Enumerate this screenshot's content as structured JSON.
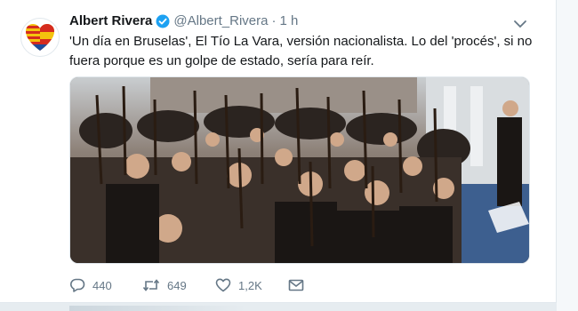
{
  "tweet": {
    "name": "Albert Rivera",
    "handle": "@Albert_Rivera",
    "separator": "·",
    "time": "1 h",
    "text": "'Un día en Bruselas', El Tío La Vara, versión nacionalista. Lo del 'procés', si no fuera porque es un golpe de estado, sería para reír.",
    "actions": {
      "replies": "440",
      "retweets": "649",
      "likes": "1,2K"
    }
  },
  "icons": {
    "verified": "verified-badge-icon",
    "more": "chevron-down-icon",
    "reply": "reply-icon",
    "retweet": "retweet-icon",
    "like": "heart-icon",
    "message": "envelope-icon"
  },
  "colors": {
    "verified_blue": "#1da1f2",
    "text": "#14171a",
    "muted": "#657786"
  }
}
